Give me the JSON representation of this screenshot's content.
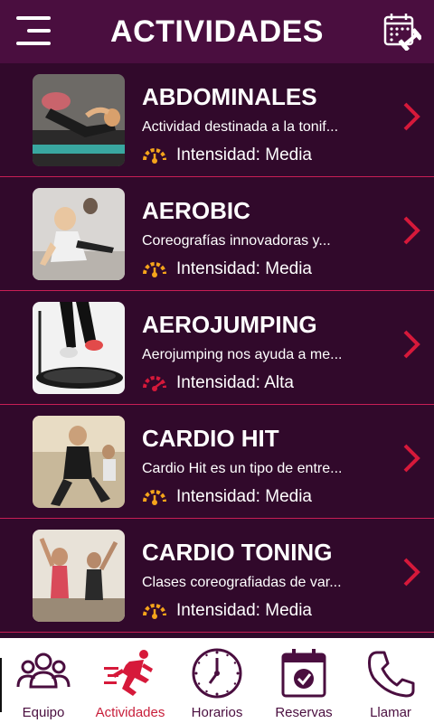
{
  "header": {
    "title": "ACTIVIDADES"
  },
  "colors": {
    "header_bg": "#4a0e3f",
    "list_bg": "#31092b",
    "divider": "#c81e55",
    "accent_red": "#d6193a",
    "intensity_media": "#f5a41b",
    "intensity_alta": "#d6193a"
  },
  "activities": [
    {
      "name": "ABDOMINALES",
      "description": "Actividad destinada a la tonif...",
      "intensity_label": "Intensidad: Media",
      "intensity": "media"
    },
    {
      "name": "AEROBIC",
      "description": "Coreografías innovadoras y...",
      "intensity_label": "Intensidad: Media",
      "intensity": "media"
    },
    {
      "name": "AEROJUMPING",
      "description": "Aerojumping nos ayuda a me...",
      "intensity_label": "Intensidad: Alta",
      "intensity": "alta"
    },
    {
      "name": "CARDIO HIT",
      "description": "Cardio Hit es un tipo de entre...",
      "intensity_label": "Intensidad: Media",
      "intensity": "media"
    },
    {
      "name": "CARDIO TONING",
      "description": "Clases coreografiadas de var...",
      "intensity_label": "Intensidad: Media",
      "intensity": "media"
    }
  ],
  "icons": {
    "menu": "hamburger-menu-icon",
    "calendar": "calendar-dumbbell-icon",
    "intensity": "gauge-icon",
    "chevron": "chevron-right-icon"
  },
  "bottom_nav": [
    {
      "label": "Equipo",
      "icon": "team-icon",
      "active": false
    },
    {
      "label": "Actividades",
      "icon": "runner-icon",
      "active": true
    },
    {
      "label": "Horarios",
      "icon": "clock-icon",
      "active": false
    },
    {
      "label": "Reservas",
      "icon": "calendar-check-icon",
      "active": false
    },
    {
      "label": "Llamar",
      "icon": "phone-icon",
      "active": false
    }
  ]
}
